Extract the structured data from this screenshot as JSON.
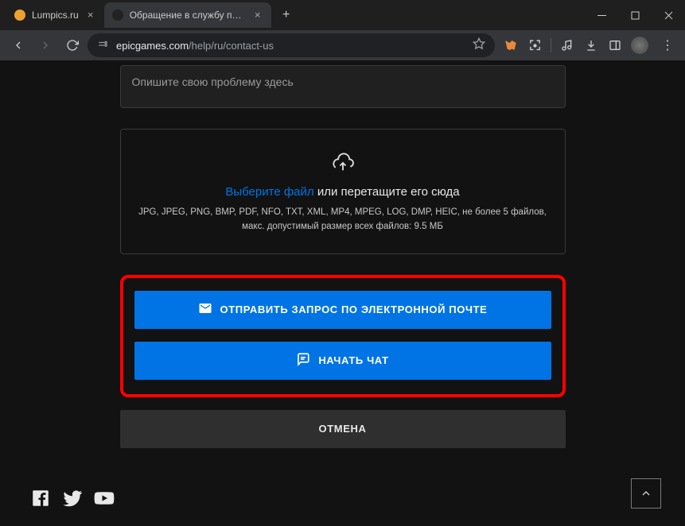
{
  "window": {
    "tabs": [
      {
        "title": "Lumpics.ru",
        "active": false
      },
      {
        "title": "Обращение в службу поддер",
        "active": true
      }
    ]
  },
  "address": {
    "domain": "epicgames.com",
    "path": "/help/ru/contact-us"
  },
  "form": {
    "describe_placeholder": "Опишите свою проблему здесь",
    "upload": {
      "choose_file": "Выберите файл",
      "drag_suffix": " или перетащите его сюда",
      "formats": "JPG, JPEG, PNG, BMP, PDF, NFO, TXT, XML, MP4, MPEG, LOG, DMP, HEIC, не более 5 файлов, макс. допустимый размер всех файлов: 9.5 МБ"
    },
    "email_label": "ОТПРАВИТЬ ЗАПРОС ПО ЭЛЕКТРОННОЙ ПОЧТЕ",
    "chat_label": "НАЧАТЬ ЧАТ",
    "cancel_label": "ОТМЕНА"
  }
}
